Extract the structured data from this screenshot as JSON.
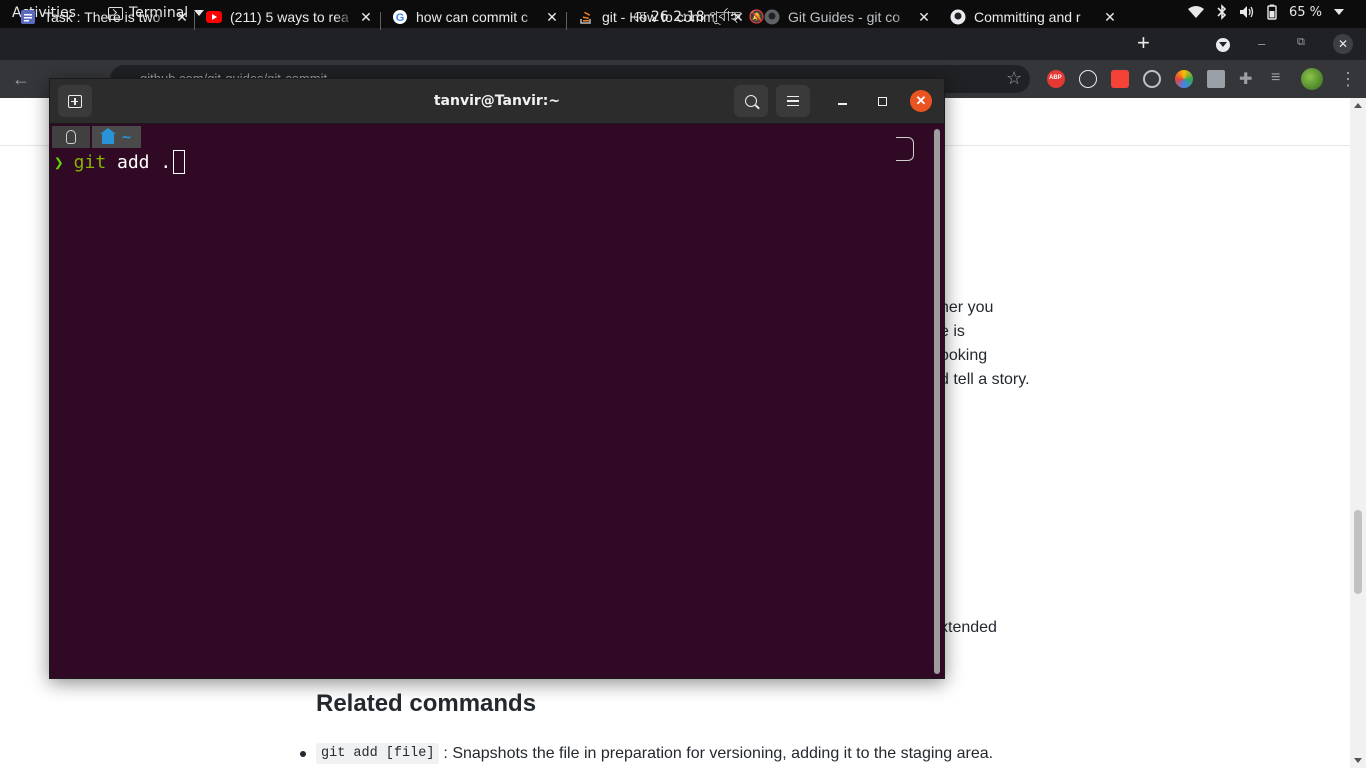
{
  "topbar": {
    "activities": "Activities",
    "app_name": "Terminal",
    "clock": "মে 26   2:18 পূর্বাহ্ন",
    "battery": "65 %"
  },
  "browser": {
    "tabs": [
      {
        "title": "Task : There is two",
        "favicon": "docs-icon"
      },
      {
        "title": "(211) 5 ways to rea",
        "favicon": "youtube-icon"
      },
      {
        "title": "how can commit c",
        "favicon": "google-icon"
      },
      {
        "title": "git - How to comm",
        "favicon": "stackoverflow-icon"
      },
      {
        "title": "Git Guides - git co",
        "favicon": "github-icon"
      },
      {
        "title": "Committing and r",
        "favicon": "github-icon"
      }
    ],
    "address": "github.com/git-guides/git-commit"
  },
  "page": {
    "peek_lines": [
      "her you",
      "e is",
      "ooking",
      "d tell a story."
    ],
    "peek_extended": "xtended",
    "related_title": "Related commands",
    "related_items": [
      {
        "code": "git add [file]",
        "text": ": Snapshots the file in preparation for versioning, adding it to the staging area."
      }
    ]
  },
  "terminal": {
    "title": "tanvir@Tanvir:~",
    "prompt_dir": "~",
    "prompt_symbol": "❯",
    "command": "git",
    "args": " add ."
  },
  "colors": {
    "terminal_bg": "#300a24",
    "accent_close": "#e95420",
    "prompt_green": "#5fd700"
  }
}
